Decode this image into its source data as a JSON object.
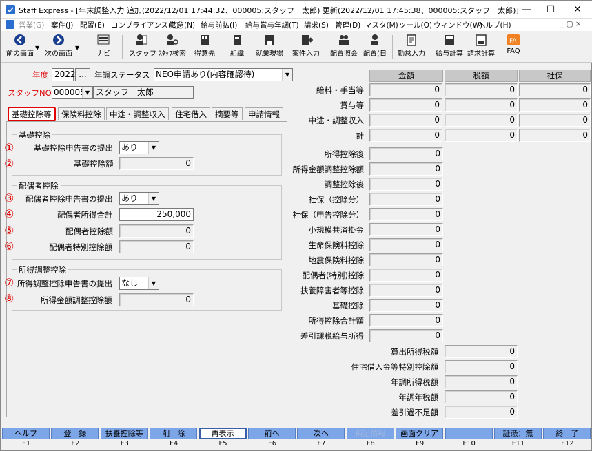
{
  "window": {
    "title": "Staff Express - [年末調整入力 追加(2022/12/01 17:44:32、000005:スタッフ　太郎) 更新(2022/12/01 17:45:38、000005:スタッフ　太郎)]"
  },
  "menu": [
    "営業(G)",
    "案件(J)",
    "配置(E)",
    "コンプライアンス(C)",
    "勤怠(N)",
    "給与前払(I)",
    "給与賞与年調(T)",
    "請求(S)",
    "管理(D)",
    "マスタ(M)",
    "ツール(O)",
    "ウィンドウ(W)",
    "ヘルプ(H)"
  ],
  "toolbar": {
    "prev": "前の画面",
    "next": "次の画面",
    "navi": "ナビ",
    "staff": "スタッフ",
    "staff_search": "ｽﾀｯﾌ検索",
    "client": "得意先",
    "org": "組織",
    "site": "就業現場",
    "job_input": "案件入力",
    "assign_ref": "配置照会",
    "assign_day": "配置(日",
    "attendance": "勤怠入力",
    "pay_calc": "給与計算",
    "bill_calc": "請求計算",
    "faq": "FAQ"
  },
  "form": {
    "year_label": "年度",
    "year_value": "2022",
    "ellipsis": "...",
    "status_label": "年調ステータス",
    "status_value": "NEO申請あり(内容確認待)",
    "staff_label": "スタッフNO",
    "staff_no": "000005",
    "staff_name": "スタッフ　太郎"
  },
  "tabs": [
    "基礎控除等",
    "保険料控除",
    "中途・調整収入",
    "住宅借入",
    "摘要等",
    "申請情報"
  ],
  "groups": {
    "basic": "基礎控除",
    "spouse": "配偶者控除",
    "income_adj": "所得調整控除"
  },
  "markers": [
    "①",
    "②",
    "③",
    "④",
    "⑤",
    "⑥",
    "⑦",
    "⑧"
  ],
  "fields": {
    "basic_submit_label": "基礎控除申告書の提出",
    "basic_submit_value": "あり",
    "basic_amount_label": "基礎控除額",
    "basic_amount_value": "0",
    "spouse_submit_label": "配偶者控除申告書の提出",
    "spouse_submit_value": "あり",
    "spouse_income_label": "配偶者所得合計",
    "spouse_income_value": "250,000",
    "spouse_deduct_label": "配偶者控除額",
    "spouse_deduct_value": "0",
    "spouse_special_label": "配偶者特別控除額",
    "spouse_special_value": "0",
    "adj_submit_label": "所得調整控除申告書の提出",
    "adj_submit_value": "なし",
    "adj_amount_label": "所得金額調整控除額",
    "adj_amount_value": "0"
  },
  "summary": {
    "headers": [
      "金額",
      "税額",
      "社保"
    ],
    "rows3": [
      {
        "label": "給料・手当等",
        "v": [
          "0",
          "0",
          "0"
        ]
      },
      {
        "label": "賞与等",
        "v": [
          "0",
          "0",
          "0"
        ]
      },
      {
        "label": "中途・調整収入",
        "v": [
          "0",
          "0",
          "0"
        ]
      },
      {
        "label": "計",
        "v": [
          "0",
          "0",
          "0"
        ]
      }
    ],
    "rows1": [
      {
        "label": "所得控除後",
        "v": "0"
      },
      {
        "label": "所得金額調整控除額",
        "v": "0"
      },
      {
        "label": "調整控除後",
        "v": "0"
      },
      {
        "label": "社保（控除分）",
        "v": "0"
      },
      {
        "label": "社保（申告控除分）",
        "v": "0"
      },
      {
        "label": "小規模共済掛金",
        "v": "0"
      },
      {
        "label": "生命保険料控除",
        "v": "0"
      },
      {
        "label": "地震保険料控除",
        "v": "0"
      },
      {
        "label": "配偶者(特別)控除",
        "v": "0"
      },
      {
        "label": "扶養障害者等控除",
        "v": "0"
      },
      {
        "label": "基礎控除",
        "v": "0"
      },
      {
        "label": "所得控除合計額",
        "v": "0"
      },
      {
        "label": "差引課税給与所得",
        "v": "0"
      }
    ],
    "rows2": [
      {
        "label": "算出所得税額",
        "v": "0"
      },
      {
        "label": "住宅借入金等特別控除額",
        "v": "0"
      },
      {
        "label": "年調所得税額",
        "v": "0"
      },
      {
        "label": "年調年税額",
        "v": "0"
      },
      {
        "label": "差引過不足額",
        "v": "0"
      }
    ]
  },
  "fkeys": [
    {
      "label": "ヘルプ",
      "key": "F1"
    },
    {
      "label": "登　録",
      "key": "F2"
    },
    {
      "label": "扶養控除等",
      "key": "F3"
    },
    {
      "label": "削　除",
      "key": "F4"
    },
    {
      "label": "再表示",
      "key": "F5"
    },
    {
      "label": "前へ",
      "key": "F6"
    },
    {
      "label": "次へ",
      "key": "F7"
    },
    {
      "label": "補足情報",
      "key": "F8"
    },
    {
      "label": "画面クリア",
      "key": "F9"
    },
    {
      "label": "",
      "key": "F10"
    },
    {
      "label": "証憑：無",
      "key": "F11"
    },
    {
      "label": "終　了",
      "key": "F12"
    }
  ]
}
